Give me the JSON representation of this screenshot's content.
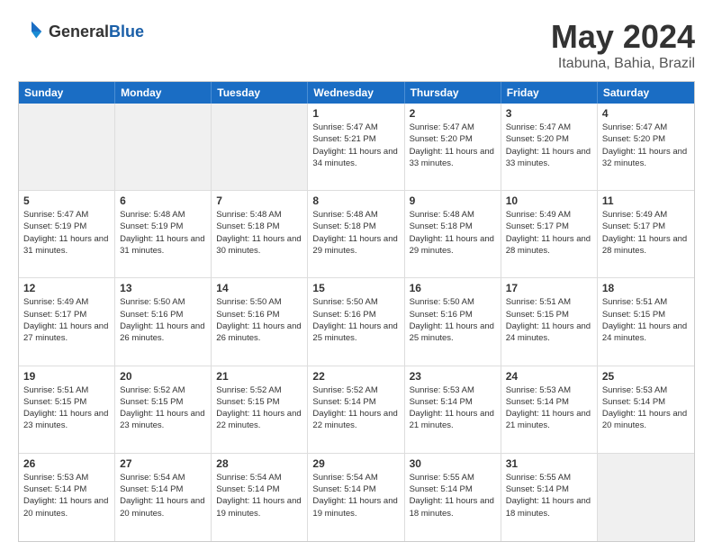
{
  "header": {
    "logo_general": "General",
    "logo_blue": "Blue",
    "title": "May 2024",
    "location": "Itabuna, Bahia, Brazil"
  },
  "weekdays": [
    "Sunday",
    "Monday",
    "Tuesday",
    "Wednesday",
    "Thursday",
    "Friday",
    "Saturday"
  ],
  "weeks": [
    [
      {
        "day": "",
        "empty": true
      },
      {
        "day": "",
        "empty": true
      },
      {
        "day": "",
        "empty": true
      },
      {
        "day": "1",
        "sunrise": "5:47 AM",
        "sunset": "5:21 PM",
        "daylight": "11 hours and 34 minutes."
      },
      {
        "day": "2",
        "sunrise": "5:47 AM",
        "sunset": "5:20 PM",
        "daylight": "11 hours and 33 minutes."
      },
      {
        "day": "3",
        "sunrise": "5:47 AM",
        "sunset": "5:20 PM",
        "daylight": "11 hours and 33 minutes."
      },
      {
        "day": "4",
        "sunrise": "5:47 AM",
        "sunset": "5:20 PM",
        "daylight": "11 hours and 32 minutes."
      }
    ],
    [
      {
        "day": "5",
        "sunrise": "5:47 AM",
        "sunset": "5:19 PM",
        "daylight": "11 hours and 31 minutes."
      },
      {
        "day": "6",
        "sunrise": "5:48 AM",
        "sunset": "5:19 PM",
        "daylight": "11 hours and 31 minutes."
      },
      {
        "day": "7",
        "sunrise": "5:48 AM",
        "sunset": "5:18 PM",
        "daylight": "11 hours and 30 minutes."
      },
      {
        "day": "8",
        "sunrise": "5:48 AM",
        "sunset": "5:18 PM",
        "daylight": "11 hours and 29 minutes."
      },
      {
        "day": "9",
        "sunrise": "5:48 AM",
        "sunset": "5:18 PM",
        "daylight": "11 hours and 29 minutes."
      },
      {
        "day": "10",
        "sunrise": "5:49 AM",
        "sunset": "5:17 PM",
        "daylight": "11 hours and 28 minutes."
      },
      {
        "day": "11",
        "sunrise": "5:49 AM",
        "sunset": "5:17 PM",
        "daylight": "11 hours and 28 minutes."
      }
    ],
    [
      {
        "day": "12",
        "sunrise": "5:49 AM",
        "sunset": "5:17 PM",
        "daylight": "11 hours and 27 minutes."
      },
      {
        "day": "13",
        "sunrise": "5:50 AM",
        "sunset": "5:16 PM",
        "daylight": "11 hours and 26 minutes."
      },
      {
        "day": "14",
        "sunrise": "5:50 AM",
        "sunset": "5:16 PM",
        "daylight": "11 hours and 26 minutes."
      },
      {
        "day": "15",
        "sunrise": "5:50 AM",
        "sunset": "5:16 PM",
        "daylight": "11 hours and 25 minutes."
      },
      {
        "day": "16",
        "sunrise": "5:50 AM",
        "sunset": "5:16 PM",
        "daylight": "11 hours and 25 minutes."
      },
      {
        "day": "17",
        "sunrise": "5:51 AM",
        "sunset": "5:15 PM",
        "daylight": "11 hours and 24 minutes."
      },
      {
        "day": "18",
        "sunrise": "5:51 AM",
        "sunset": "5:15 PM",
        "daylight": "11 hours and 24 minutes."
      }
    ],
    [
      {
        "day": "19",
        "sunrise": "5:51 AM",
        "sunset": "5:15 PM",
        "daylight": "11 hours and 23 minutes."
      },
      {
        "day": "20",
        "sunrise": "5:52 AM",
        "sunset": "5:15 PM",
        "daylight": "11 hours and 23 minutes."
      },
      {
        "day": "21",
        "sunrise": "5:52 AM",
        "sunset": "5:15 PM",
        "daylight": "11 hours and 22 minutes."
      },
      {
        "day": "22",
        "sunrise": "5:52 AM",
        "sunset": "5:14 PM",
        "daylight": "11 hours and 22 minutes."
      },
      {
        "day": "23",
        "sunrise": "5:53 AM",
        "sunset": "5:14 PM",
        "daylight": "11 hours and 21 minutes."
      },
      {
        "day": "24",
        "sunrise": "5:53 AM",
        "sunset": "5:14 PM",
        "daylight": "11 hours and 21 minutes."
      },
      {
        "day": "25",
        "sunrise": "5:53 AM",
        "sunset": "5:14 PM",
        "daylight": "11 hours and 20 minutes."
      }
    ],
    [
      {
        "day": "26",
        "sunrise": "5:53 AM",
        "sunset": "5:14 PM",
        "daylight": "11 hours and 20 minutes."
      },
      {
        "day": "27",
        "sunrise": "5:54 AM",
        "sunset": "5:14 PM",
        "daylight": "11 hours and 20 minutes."
      },
      {
        "day": "28",
        "sunrise": "5:54 AM",
        "sunset": "5:14 PM",
        "daylight": "11 hours and 19 minutes."
      },
      {
        "day": "29",
        "sunrise": "5:54 AM",
        "sunset": "5:14 PM",
        "daylight": "11 hours and 19 minutes."
      },
      {
        "day": "30",
        "sunrise": "5:55 AM",
        "sunset": "5:14 PM",
        "daylight": "11 hours and 18 minutes."
      },
      {
        "day": "31",
        "sunrise": "5:55 AM",
        "sunset": "5:14 PM",
        "daylight": "11 hours and 18 minutes."
      },
      {
        "day": "",
        "empty": true
      }
    ]
  ]
}
